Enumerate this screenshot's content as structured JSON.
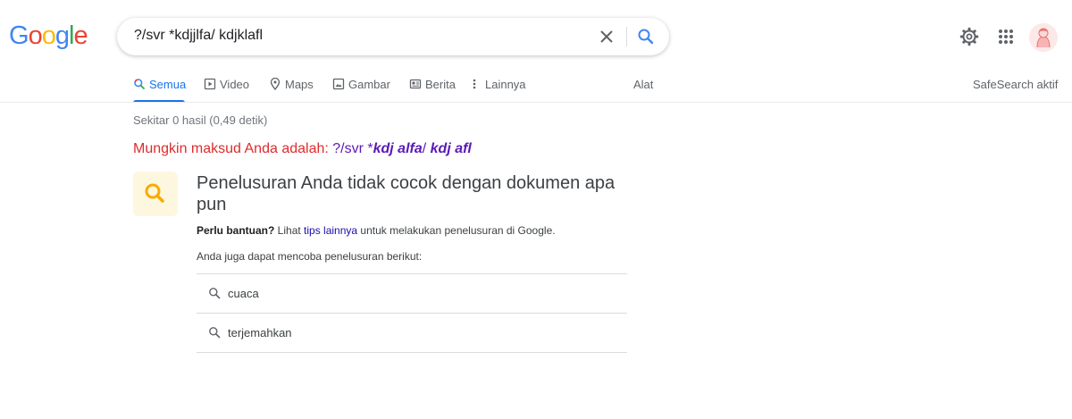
{
  "header": {
    "logo_letters": [
      "G",
      "o",
      "o",
      "g",
      "l",
      "e"
    ],
    "logo_colors": [
      "#4285f4",
      "#ea4335",
      "#fbbc05",
      "#4285f4",
      "#34a853",
      "#ea4335"
    ],
    "search": {
      "query": "?/svr *kdjjlfa/ kdjklafl",
      "clear_icon": "close-icon",
      "search_icon": "search-icon"
    },
    "settings_icon": "gear-icon",
    "apps_icon": "apps-grid-icon",
    "avatar_icon": "profile-avatar"
  },
  "tabs": [
    {
      "label": "Semua",
      "icon": "search-icon",
      "active": true
    },
    {
      "label": "Video",
      "icon": "video-icon",
      "active": false
    },
    {
      "label": "Maps",
      "icon": "map-pin-icon",
      "active": false
    },
    {
      "label": "Gambar",
      "icon": "image-icon",
      "active": false
    },
    {
      "label": "Berita",
      "icon": "news-icon",
      "active": false
    },
    {
      "label": "Lainnya",
      "icon": "more-vert-icon",
      "active": false
    }
  ],
  "tools_label": "Alat",
  "safesearch_label": "SafeSearch aktif",
  "result_stats": "Sekitar 0 hasil (0,49 detik)",
  "did_you_mean": {
    "prefix": "Mungkin maksud Anda adalah:",
    "part1": "?/svr *",
    "part2": "kdj alfa",
    "part3": "/ ",
    "part4": "kdj afl"
  },
  "no_results": {
    "title": "Penelusuran Anda tidak cocok dengan dokumen apa pun",
    "help_bold": "Perlu bantuan?",
    "help_pre": " Lihat ",
    "help_link": "tips lainnya",
    "help_post": " untuk melakukan penelusuran di Google.",
    "try_also": "Anda juga dapat mencoba penelusuran berikut:",
    "suggestions": [
      "cuaca",
      "terjemahkan"
    ]
  },
  "colors": {
    "accent": "#1a73e8",
    "did_you_mean_red": "#dd2c2c",
    "correction_purple": "#5a1ab6",
    "link": "#1a0dab",
    "icon_box": "#fef7e0",
    "icon_yellow": "#f9ab00"
  }
}
